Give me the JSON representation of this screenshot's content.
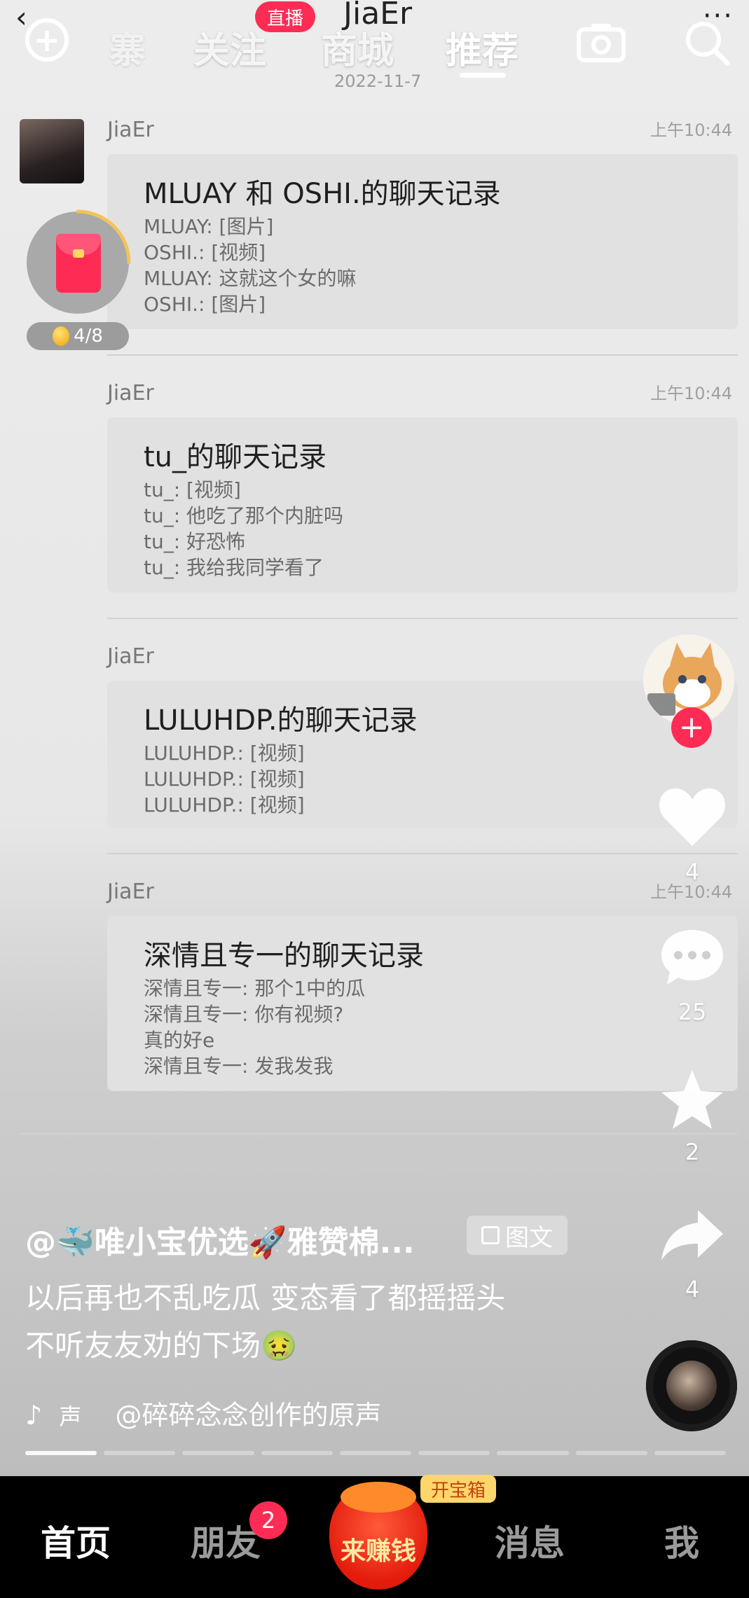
{
  "header": {
    "tabs": [
      {
        "label": "寨"
      },
      {
        "label": "关注"
      },
      {
        "label": "商城"
      },
      {
        "label": "推荐"
      }
    ],
    "live_badge": "直播",
    "sheet_title": "JiaEr",
    "sheet_date": "2022-11-7"
  },
  "red_packet": {
    "progress_text": "4/8"
  },
  "messages": [
    {
      "sender": "JiaEr",
      "time": "上午10:44",
      "title": "MLUAY 和 OSHI.的聊天记录",
      "lines": [
        "MLUAY: [图片]",
        "OSHI.: [视频]",
        "MLUAY: 这就这个女的嘛",
        "OSHI.: [图片]"
      ]
    },
    {
      "sender": "JiaEr",
      "time": "上午10:44",
      "title": "tu_的聊天记录",
      "lines": [
        "tu_: [视频]",
        "tu_: 他吃了那个内脏吗",
        "tu_: 好恐怖",
        "tu_: 我给我同学看了"
      ]
    },
    {
      "sender": "JiaEr",
      "time": "",
      "title": "LULUHDP.的聊天记录",
      "lines": [
        "LULUHDP.: [视频]",
        "LULUHDP.: [视频]",
        "LULUHDP.: [视频]"
      ]
    },
    {
      "sender": "JiaEr",
      "time": "上午10:44",
      "title": "深情且专一的聊天记录",
      "lines": [
        "深情且专一: 那个1中的瓜",
        "深情且专一: 你有视频?",
        "真的好e",
        "深情且专一: 发我发我"
      ]
    }
  ],
  "actions": {
    "likes": "4",
    "comments": "25",
    "favorites": "2",
    "shares": "4"
  },
  "post": {
    "author": "@🐳唯小宝优选🚀雅赞棉...",
    "type_label": "图文",
    "caption_line1": "以后再也不乱吃瓜 变态看了都摇摇头",
    "caption_line2": "不听友友劝的下场🤢",
    "music_prefix": "声",
    "music": "@碎碎念念创作的原声"
  },
  "nav": {
    "home": "首页",
    "friends": "朋友",
    "friends_badge": "2",
    "earn": "来赚钱",
    "chest": "开宝箱",
    "messages": "消息",
    "me": "我"
  },
  "colors": {
    "accent": "#fe2c55",
    "coin": "#f0a400",
    "earn": "#e31b0c"
  }
}
